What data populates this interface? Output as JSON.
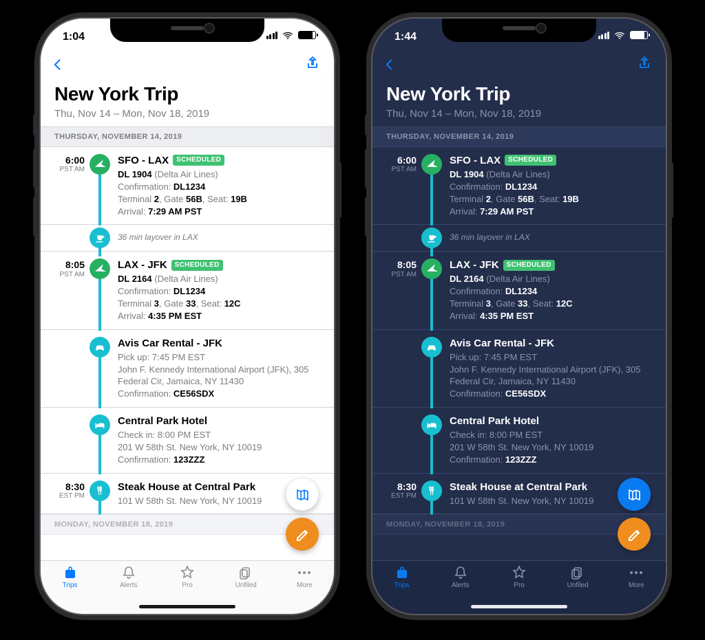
{
  "light": {
    "status_time": "1:04",
    "title": "New York Trip",
    "date_range": "Thu, Nov 14 – Mon, Nov 18, 2019",
    "section1": "THURSDAY, NOVEMBER 14, 2019",
    "section2": "MONDAY, NOVEMBER 18, 2019",
    "f1": {
      "time": "6:00",
      "zone": "PST AM",
      "route": "SFO - LAX",
      "badge": "SCHEDULED",
      "flightno": "DL 1904",
      "airline": " (Delta Air Lines)",
      "conf_label": "Confirmation: ",
      "conf": "DL1234",
      "term_a": "Terminal ",
      "term_v": "2",
      "gate_a": ", Gate ",
      "gate_v": "56B",
      "seat_a": ", Seat: ",
      "seat_v": "19B",
      "arr_a": "Arrival: ",
      "arr_v": "7:29 AM PST"
    },
    "layover": "36 min layover in LAX",
    "f2": {
      "time": "8:05",
      "zone": "PST AM",
      "route": "LAX - JFK",
      "badge": "SCHEDULED",
      "flightno": "DL 2164",
      "airline": " (Delta Air Lines)",
      "conf_label": "Confirmation: ",
      "conf": "DL1234",
      "term_a": "Terminal ",
      "term_v": "3",
      "gate_a": ", Gate ",
      "gate_v": "33",
      "seat_a": ", Seat: ",
      "seat_v": "12C",
      "arr_a": "Arrival: ",
      "arr_v": "4:35 PM EST"
    },
    "car": {
      "title": "Avis Car Rental - JFK",
      "pickup": "Pick up: 7:45 PM EST",
      "addr": "John F. Kennedy International Airport (JFK), 305 Federal Cir, Jamaica, NY 11430",
      "conf_label": "Confirmation: ",
      "conf": "CE56SDX"
    },
    "hotel": {
      "title": "Central Park Hotel",
      "checkin": "Check in: 8:00 PM EST",
      "addr": "201 W 58th St. New York, NY 10019",
      "conf_label": "Confirmation: ",
      "conf": "123ZZZ"
    },
    "meal": {
      "time": "8:30",
      "zone": "EST PM",
      "title": "Steak House at Central Park",
      "addr": "101 W 58th St. New York, NY 10019"
    },
    "tabs": {
      "trips": "Trips",
      "alerts": "Alerts",
      "pro": "Pro",
      "unfiled": "Unfiled",
      "more": "More"
    }
  },
  "dark": {
    "status_time": "1:44",
    "title": "New York Trip",
    "date_range": "Thu, Nov 14 – Mon, Nov 18, 2019",
    "section1": "THURSDAY, NOVEMBER 14, 2019",
    "section2": "MONDAY, NOVEMBER 18, 2019",
    "f1": {
      "time": "6:00",
      "zone": "PST AM",
      "route": "SFO - LAX",
      "badge": "SCHEDULED",
      "flightno": "DL 1904",
      "airline": " (Delta Air Lines)",
      "conf_label": "Confirmation: ",
      "conf": "DL1234",
      "term_a": "Terminal ",
      "term_v": "2",
      "gate_a": ", Gate ",
      "gate_v": "56B",
      "seat_a": ", Seat: ",
      "seat_v": "19B",
      "arr_a": "Arrival: ",
      "arr_v": "7:29 AM PST"
    },
    "layover": "36 min layover in LAX",
    "f2": {
      "time": "8:05",
      "zone": "PST AM",
      "route": "LAX - JFK",
      "badge": "SCHEDULED",
      "flightno": "DL 2164",
      "airline": " (Delta Air Lines)",
      "conf_label": "Confirmation: ",
      "conf": "DL1234",
      "term_a": "Terminal ",
      "term_v": "3",
      "gate_a": ", Gate ",
      "gate_v": "33",
      "seat_a": ", Seat: ",
      "seat_v": "12C",
      "arr_a": "Arrival: ",
      "arr_v": "4:35 PM EST"
    },
    "car": {
      "title": "Avis Car Rental - JFK",
      "pickup": "Pick up: 7:45 PM EST",
      "addr": "John F. Kennedy International Airport (JFK), 305 Federal Cir, Jamaica, NY 11430",
      "conf_label": "Confirmation: ",
      "conf": "CE56SDX"
    },
    "hotel": {
      "title": "Central Park Hotel",
      "checkin": "Check in: 8:00 PM EST",
      "addr": "201 W 58th St. New York, NY 10019",
      "conf_label": "Confirmation: ",
      "conf": "123ZZZ"
    },
    "meal": {
      "time": "8:30",
      "zone": "EST PM",
      "title": "Steak House at Central Park",
      "addr": "101 W 58th St. New York, NY 10019"
    },
    "tabs": {
      "trips": "Trips",
      "alerts": "Alerts",
      "pro": "Pro",
      "unfiled": "Unfiled",
      "more": "More"
    }
  }
}
